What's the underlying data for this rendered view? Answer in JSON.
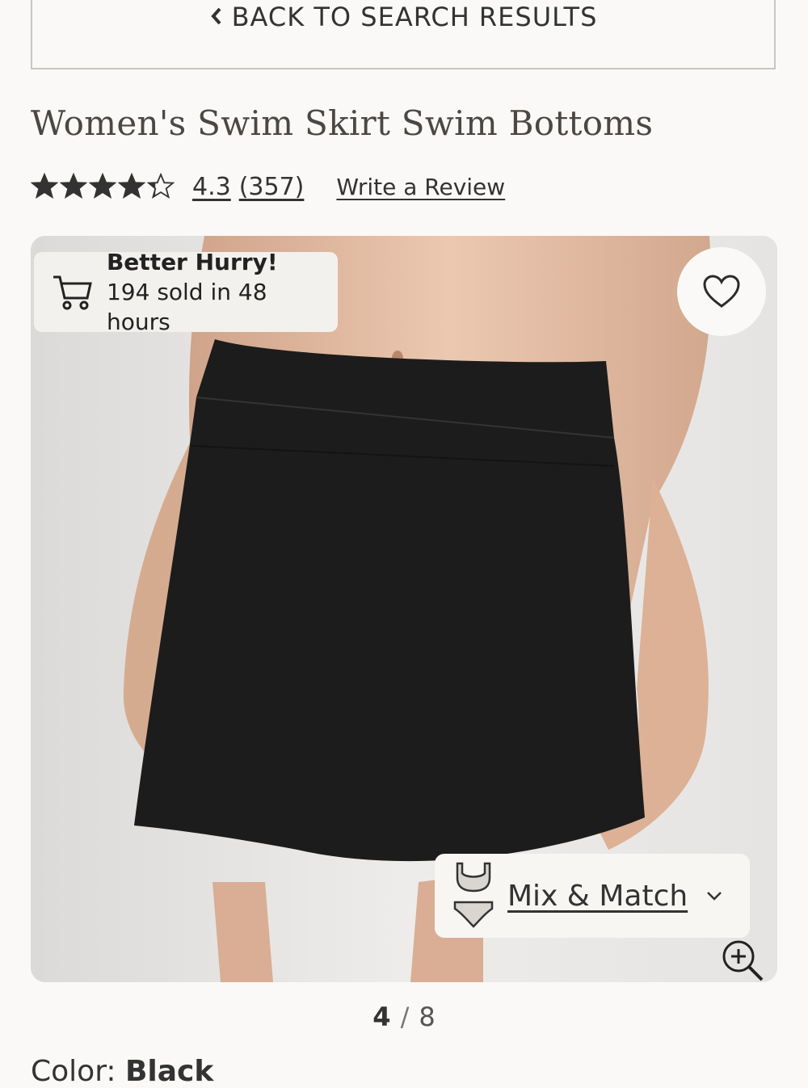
{
  "nav": {
    "back_label": "BACK TO SEARCH RESULTS"
  },
  "product": {
    "title": "Women's Swim Skirt Swim Bottoms",
    "rating": "4.3",
    "rating_value": 4.3,
    "rating_max": 5,
    "review_count": "(357)",
    "write_review_label": "Write a Review"
  },
  "badge": {
    "title": "Better Hurry!",
    "subtitle": "194 sold in 48 hours"
  },
  "mix_match": {
    "label": "Mix & Match"
  },
  "gallery": {
    "current": "4",
    "separator": "/",
    "total": "8"
  },
  "color": {
    "label": "Color:",
    "value": "Black"
  },
  "icons": {
    "back": "chevron-left-icon",
    "favorite": "heart-icon",
    "cart": "cart-icon",
    "mix": "swimsuit-set-icon",
    "expand": "chevron-down-icon",
    "zoom": "zoom-in-icon"
  },
  "colors": {
    "background": "#fbf9f7",
    "text": "#2b2b2b",
    "skirt": "#1c1c1c"
  }
}
